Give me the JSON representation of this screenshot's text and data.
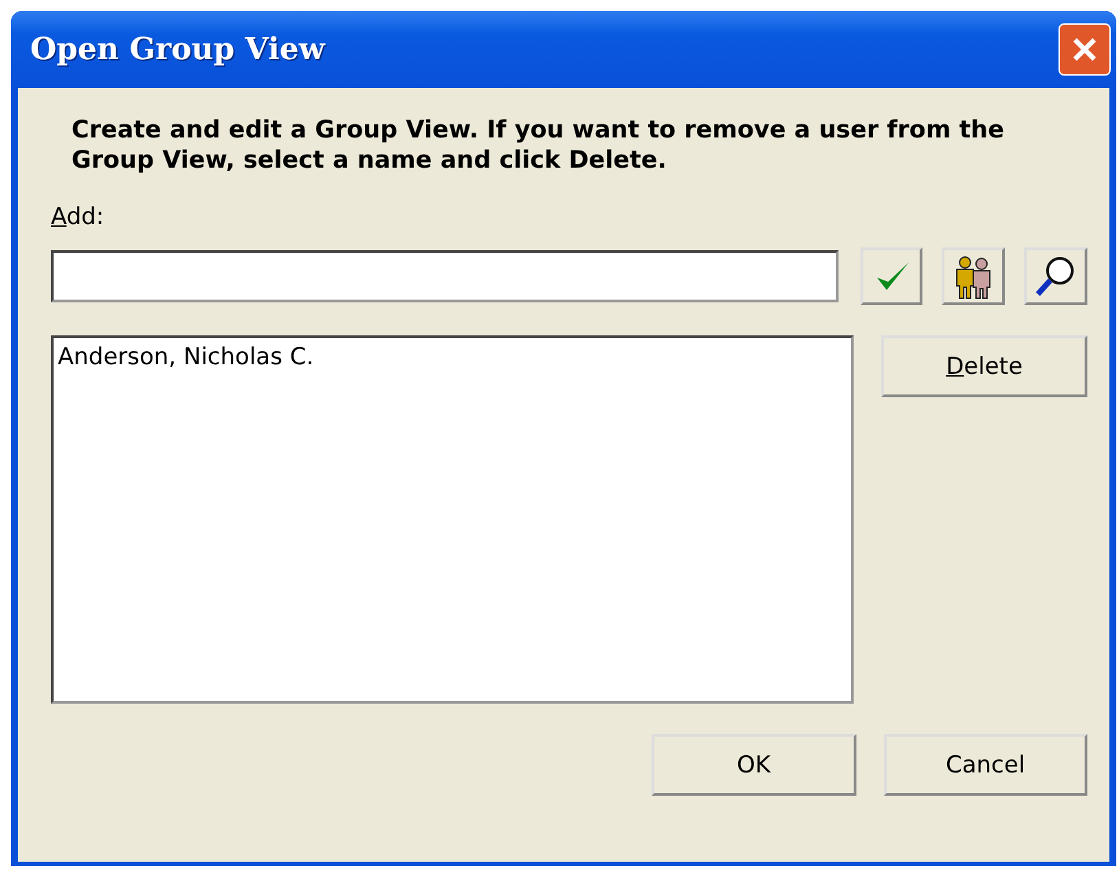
{
  "window": {
    "title": "Open Group View"
  },
  "instructions": "Create and edit a Group View. If you want to remove a user from the Group View, select a name and click Delete.",
  "add_field": {
    "label": "Add:",
    "mnemonic": true
  },
  "members": [
    {
      "name": "Anderson, Nicholas C.",
      "selected": false
    }
  ],
  "delete_button": {
    "label": "Delete",
    "mnemonic": true
  },
  "buttons": [
    {
      "label": "OK",
      "mnemonic": false
    },
    {
      "label": "Cancel",
      "mnemonic": false
    }
  ]
}
